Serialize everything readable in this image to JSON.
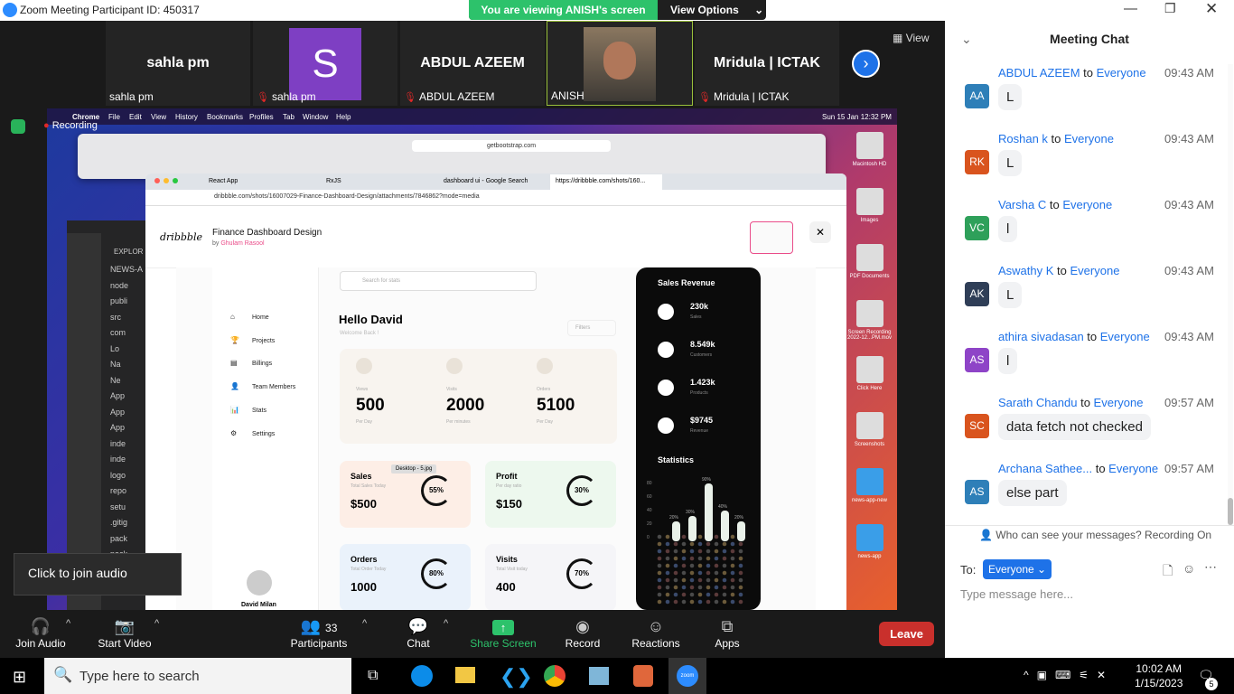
{
  "window": {
    "title": "Zoom Meeting Participant ID: 450317"
  },
  "banner": {
    "viewing": "You are viewing ANISH's screen",
    "view_options": "View Options"
  },
  "tiles": [
    {
      "name": "sahla pm",
      "label": "sahla pm"
    },
    {
      "avatar": "S",
      "label": "sahla pm"
    },
    {
      "name": "ABDUL AZEEM",
      "label": "ABDUL AZEEM"
    },
    {
      "label": "ANISH"
    },
    {
      "name": "Mridula | ICTAK",
      "label": "Mridula | ICTAK"
    }
  ],
  "view_btn": "View",
  "recording": "Recording",
  "mac": {
    "menu": [
      "Chrome",
      "File",
      "Edit",
      "View",
      "History",
      "Bookmarks",
      "Profiles",
      "Tab",
      "Window",
      "Help"
    ],
    "clock": "Sun 15 Jan 12:32 PM",
    "url_top": "getbootstrap.com"
  },
  "browser": {
    "tabs": [
      "React App",
      "RxJS",
      "dashboard ui - Google Search",
      "https://dribbble.com/shots/160..."
    ],
    "url": "dribbble.com/shots/16007029-Finance-Dashboard-Design/attachments/7846862?mode=media",
    "logo": "dribbble",
    "shot_title": "Finance Dashboard Design",
    "shot_by": "by ",
    "shot_author": "Ghulam Rasool"
  },
  "dash": {
    "search_placeholder": "Search for stats",
    "hello": "Hello David",
    "welcome": "Welcome Back !",
    "filters": "Filters",
    "nav": [
      "Home",
      "Projects",
      "Billings",
      "Team Members",
      "Stats",
      "Settings"
    ],
    "stats": [
      {
        "label": "Views",
        "value": "500",
        "sub": "Per Day"
      },
      {
        "label": "Visits",
        "value": "2000",
        "sub": "Per minutes"
      },
      {
        "label": "Orders",
        "value": "5100",
        "sub": "Per Day"
      }
    ],
    "cards": [
      {
        "title": "Sales",
        "sub": "Total Sales Today",
        "value": "$500",
        "pct": "55%"
      },
      {
        "title": "Profit",
        "sub": "Per day ratio",
        "value": "$150",
        "pct": "30%"
      },
      {
        "title": "Orders",
        "sub": "Total Order Today",
        "value": "1000",
        "pct": "80%"
      },
      {
        "title": "Visits",
        "sub": "Total Visit today",
        "value": "400",
        "pct": "70%"
      }
    ],
    "tooltip": "Desktop - 5.jpg",
    "user": "David Milan",
    "revenue_title": "Sales Revenue",
    "revenue": [
      {
        "value": "230k",
        "label": "Sales"
      },
      {
        "value": "8.549k",
        "label": "Customers"
      },
      {
        "value": "1.423k",
        "label": "Products"
      },
      {
        "value": "$9745",
        "label": "Revenue"
      }
    ],
    "statistics": "Statistics",
    "stat_axis": [
      "80",
      "60",
      "40",
      "20",
      "0"
    ],
    "stat_pcts": [
      "20%",
      "30%",
      "90%",
      "40%",
      "20%"
    ]
  },
  "vscode": {
    "explorer": "EXPLOR",
    "items": [
      "NEWS-A",
      "node",
      "publi",
      "src",
      "com",
      "Lo",
      "Na",
      "Ne",
      "App",
      "App",
      "App",
      "inde",
      "inde",
      "logo",
      "repo",
      "setu",
      ".gitig",
      "pack",
      "pack"
    ]
  },
  "desktop_icons": [
    "Macintosh HD",
    "Images",
    "PDF Documents",
    "Screen Recording 2022-12...PM.mov",
    "Click Here",
    "Screenshots",
    "news-app-new",
    "news-app"
  ],
  "chat": {
    "title": "Meeting Chat",
    "messages": [
      {
        "initials": "AA",
        "color": "#2e7fb8",
        "from": "ABDUL AZEEM",
        "to": "Everyone",
        "time": "09:43 AM",
        "text": "L"
      },
      {
        "initials": "RK",
        "color": "#d9541e",
        "from": "Roshan k",
        "to": "Everyone",
        "time": "09:43 AM",
        "text": "L"
      },
      {
        "initials": "VC",
        "color": "#2ea05a",
        "from": "Varsha C",
        "to": "Everyone",
        "time": "09:43 AM",
        "text": "l"
      },
      {
        "initials": "AK",
        "color": "#2f3e57",
        "from": "Aswathy K",
        "to": "Everyone",
        "time": "09:43 AM",
        "text": "L"
      },
      {
        "initials": "AS",
        "color": "#8e44c7",
        "from": "athira sivadasan",
        "to": "Everyone",
        "time": "09:43 AM",
        "text": "l"
      },
      {
        "initials": "SC",
        "color": "#d9541e",
        "from": "Sarath Chandu",
        "to": "Everyone",
        "time": "09:57 AM",
        "text": "data fetch not checked"
      },
      {
        "initials": "AS",
        "color": "#2e7fb8",
        "from": "Archana Sathee...",
        "to": "Everyone",
        "time": "09:57 AM",
        "text": "else part"
      }
    ],
    "to_word": "to",
    "who": "Who can see your messages? Recording On",
    "to_label": "To:",
    "recipient": "Everyone",
    "placeholder": "Type message here..."
  },
  "join_audio_tip": "Click to join audio",
  "toolbar": {
    "join_audio": "Join Audio",
    "start_video": "Start Video",
    "participants": "Participants",
    "participants_count": "33",
    "chat": "Chat",
    "share": "Share Screen",
    "record": "Record",
    "reactions": "Reactions",
    "apps": "Apps",
    "leave": "Leave"
  },
  "taskbar": {
    "search": "Type here to search",
    "time": "10:02 AM",
    "date": "1/15/2023",
    "notif": "5"
  }
}
